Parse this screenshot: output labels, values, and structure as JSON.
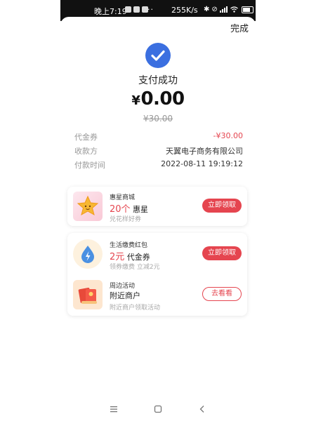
{
  "status_bar": {
    "time": "晚上7:19",
    "dots": "··",
    "speed": "255K/s",
    "battery": "86"
  },
  "header": {
    "done_label": "完成"
  },
  "payment": {
    "status": "支付成功",
    "currency_symbol": "¥",
    "amount": "0.00",
    "original_amount": "¥30.00"
  },
  "details": [
    {
      "label": "代金券",
      "value": "-¥30.00",
      "value_color": "#e5454f"
    },
    {
      "label": "收款方",
      "value": "天翼电子商务有限公司"
    },
    {
      "label": "付款时间",
      "value": "2022-08-11 19:19:12"
    }
  ],
  "promos": [
    {
      "title": "惠星商城",
      "amount": "20个",
      "unit": "惠星",
      "subtitle": "兑花样好券",
      "button": "立即领取",
      "icon": "star-icon"
    },
    {
      "title": "生活缴费红包",
      "amount": "2元",
      "unit": "代金券",
      "subtitle": "领券缴费 立减2元",
      "button": "立即领取",
      "icon": "lightning-icon"
    },
    {
      "title": "周边活动",
      "amount": "",
      "unit": "附近商户",
      "subtitle": "附近商户领取活动",
      "button": "去看看",
      "icon": "red-packet-icon"
    }
  ],
  "colors": {
    "accent_red": "#e5454f",
    "check_blue": "#3b6fe0"
  },
  "nav_icons": [
    "menu-icon",
    "home-icon",
    "back-icon"
  ]
}
